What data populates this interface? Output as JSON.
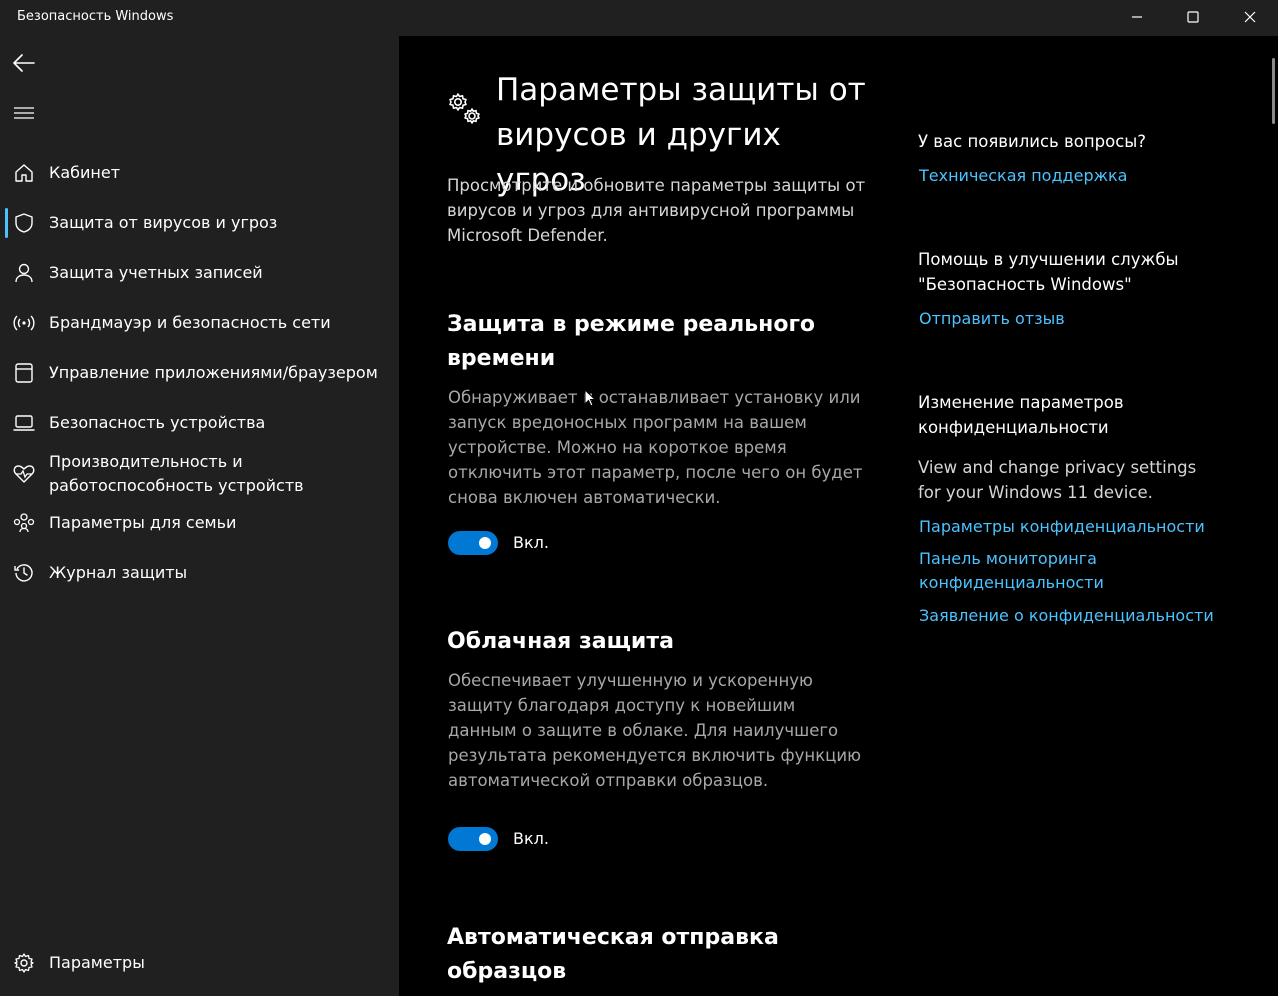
{
  "window": {
    "title": "Безопасность Windows"
  },
  "sidebar": {
    "items": [
      {
        "label": "Кабинет",
        "icon": "home-icon"
      },
      {
        "label": "Защита от вирусов и угроз",
        "icon": "shield-icon",
        "selected": true
      },
      {
        "label": "Защита учетных записей",
        "icon": "person-icon"
      },
      {
        "label": "Брандмауэр и безопасность сети",
        "icon": "wifi-signal-icon"
      },
      {
        "label": "Управление приложениями/браузером",
        "icon": "app-window-icon"
      },
      {
        "label": "Безопасность устройства",
        "icon": "laptop-icon"
      },
      {
        "label": "Производительность и работоспособность устройств",
        "icon": "heart-pulse-icon"
      },
      {
        "label": "Параметры для семьи",
        "icon": "family-icon"
      },
      {
        "label": "Журнал защиты",
        "icon": "history-icon"
      }
    ],
    "settings_label": "Параметры"
  },
  "main": {
    "title": "Параметры защиты от вирусов и других угроз",
    "description": "Просмотрите и обновите параметры защиты от вирусов и угроз для антивирусной программы Microsoft Defender.",
    "sections": [
      {
        "title": "Защита в режиме реального времени",
        "description": "Обнаруживает и останавливает установку или запуск вредоносных программ на вашем устройстве. Можно на короткое время отключить этот параметр, после чего он будет снова включен автоматически.",
        "toggle_on": true,
        "toggle_label": "Вкл."
      },
      {
        "title": "Облачная защита",
        "description": "Обеспечивает улучшенную и ускоренную защиту благодаря доступу к новейшим данным о защите в облаке. Для наилучшего результата рекомендуется включить функцию автоматической отправки образцов.",
        "toggle_on": true,
        "toggle_label": "Вкл."
      },
      {
        "title": "Автоматическая отправка образцов"
      }
    ]
  },
  "right": {
    "questions_heading": "У вас появились вопросы?",
    "support_link": "Техническая поддержка",
    "improve_heading": "Помощь в улучшении службы \"Безопасность Windows\"",
    "feedback_link": "Отправить отзыв",
    "privacy_heading": "Изменение параметров конфиденциальности",
    "privacy_text": "View and change privacy settings for your Windows 11 device.",
    "privacy_links": [
      "Параметры конфиденциальности",
      "Панель мониторинга конфиденциальности",
      "Заявление о конфиденциальности"
    ]
  },
  "colors": {
    "accent": "#0078d4",
    "link": "#4cc2ff",
    "sidebar_bg": "#202020",
    "main_bg": "#000000"
  }
}
